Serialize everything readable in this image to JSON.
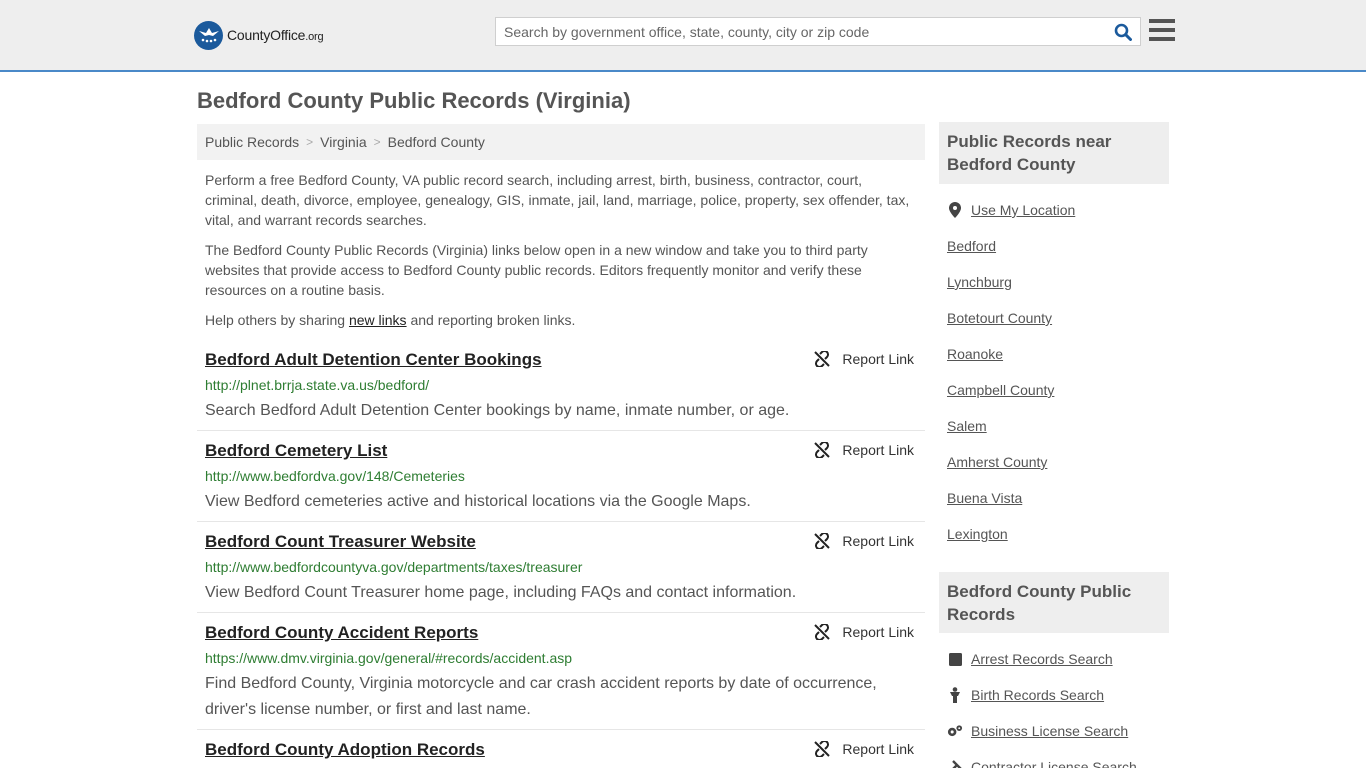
{
  "header": {
    "brand_main": "CountyOffice",
    "brand_tld": ".org",
    "search_placeholder": "Search by government office, state, county, city or zip code"
  },
  "page_title": "Bedford County Public Records (Virginia)",
  "breadcrumb": [
    "Public Records",
    "Virginia",
    "Bedford County"
  ],
  "intro": {
    "p1": "Perform a free Bedford County, VA public record search, including arrest, birth, business, contractor, court, criminal, death, divorce, employee, genealogy, GIS, inmate, jail, land, marriage, police, property, sex offender, tax, vital, and warrant records searches.",
    "p2": "The Bedford County Public Records (Virginia) links below open in a new window and take you to third party websites that provide access to Bedford County public records. Editors frequently monitor and verify these resources on a routine basis.",
    "p3_before": "Help others by sharing ",
    "p3_link": "new links",
    "p3_after": " and reporting broken links."
  },
  "report_label": "Report Link",
  "records": [
    {
      "title": "Bedford Adult Detention Center Bookings",
      "url": "http://plnet.brrja.state.va.us/bedford/",
      "desc": "Search Bedford Adult Detention Center bookings by name, inmate number, or age."
    },
    {
      "title": "Bedford Cemetery List",
      "url": "http://www.bedfordva.gov/148/Cemeteries",
      "desc": "View Bedford cemeteries active and historical locations via the Google Maps."
    },
    {
      "title": "Bedford Count Treasurer Website",
      "url": "http://www.bedfordcountyva.gov/departments/taxes/treasurer",
      "desc": "View Bedford Count Treasurer home page, including FAQs and contact information."
    },
    {
      "title": "Bedford County Accident Reports",
      "url": "https://www.dmv.virginia.gov/general/#records/accident.asp",
      "desc": "Find Bedford County, Virginia motorcycle and car crash accident reports by date of occurrence, driver's license number, or first and last name."
    },
    {
      "title": "Bedford County Adoption Records",
      "url": "",
      "desc": ""
    }
  ],
  "sidebar": {
    "near_title": "Public Records near Bedford County",
    "use_location": "Use My Location",
    "near": [
      "Bedford",
      "Lynchburg",
      "Botetourt County",
      "Roanoke",
      "Campbell County",
      "Salem",
      "Amherst County",
      "Buena Vista",
      "Lexington"
    ],
    "records_title": "Bedford County Public Records",
    "record_links": [
      {
        "label": "Arrest Records Search",
        "icon": "square-icon"
      },
      {
        "label": "Birth Records Search",
        "icon": "person-icon"
      },
      {
        "label": "Business License Search",
        "icon": "gears-icon"
      },
      {
        "label": "Contractor License Search",
        "icon": "tools-icon"
      }
    ]
  }
}
